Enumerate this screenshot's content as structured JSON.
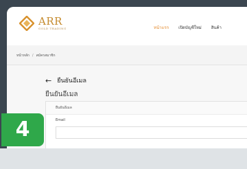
{
  "logo": {
    "main": "ARR",
    "sub": "GOLD TRADING"
  },
  "nav": [
    "หน้าแรก",
    "เปิดบัญชีใหม่",
    "สินค้า"
  ],
  "breadcrumb": [
    "หน้าหลัก",
    "สมัครสมาชิก"
  ],
  "back_label": "ยืนยันอีเมล",
  "page_title": "ยืนยันอีเมล",
  "card": {
    "header": "ยืนยันอีเมล",
    "field_label": "Email"
  },
  "step_badge": "4",
  "colors": {
    "accent": "#e58a2c",
    "logo": "#c58a2c",
    "badge": "#2fa84a"
  }
}
